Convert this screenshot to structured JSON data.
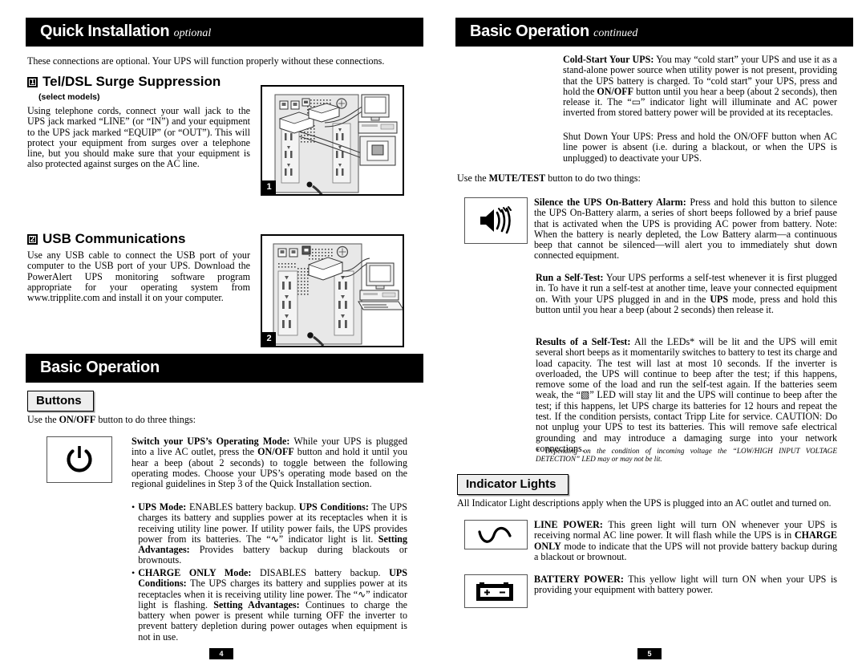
{
  "left_column": {
    "banner": {
      "title": "Quick Installation",
      "suffix": "optional"
    },
    "intro": "These connections are optional. Your UPS will function properly without these connections.",
    "step1": {
      "number": "1",
      "heading": "Tel/DSL Surge Suppression",
      "subnote": "(select models)",
      "body": "Using telephone cords, connect your wall jack to the UPS jack marked “LINE” (or “IN”) and  your equipment to the UPS jack marked “EQUIP” (or “OUT”). This will protect your equipment from surges over a telephone line, but you should make sure that your equipment is also protected against surges on the AC line.",
      "illustration_tag": "1"
    },
    "step2": {
      "number": "2",
      "heading": "USB Communications",
      "body": "Use any USB cable to connect the USB port of your computer to the USB port of your UPS. Download the PowerAlert UPS monitoring software program appropriate for your operating system from www.tripplite.com and install it on your computer.",
      "illustration_tag": "2"
    },
    "banner2": {
      "title": "Basic Operation",
      "suffix": ""
    },
    "buttons_head": "Buttons",
    "buttons_intro_pre": "Use the ",
    "buttons_intro_bold": "ON/OFF",
    "buttons_intro_post": " button to do three things:",
    "switch_mode": {
      "lead": "Switch your UPS’s Operating Mode:",
      "text_a": " While your UPS is plugged into a live AC outlet, press the ",
      "bold_b": "ON/OFF",
      "text_c": " button and hold it until you hear a beep (about 2 seconds) to toggle between the following operating modes. Choose your UPS’s operating mode based on the regional guidelines in Step 3 of the Quick Installation section.",
      "icon": "power-button-icon"
    },
    "ups_mode": {
      "bullet": "•",
      "lead": "UPS Mode:",
      "text_a": " ENABLES battery backup. ",
      "bold_b": "UPS Conditions:",
      "text_c": " The UPS charges its battery and supplies power at its receptacles when it is receiving utility line power. If utility power fails, the UPS provides power from its batteries. The “",
      "glyph": "∿",
      "text_d": "” indicator light is lit. ",
      "bold_e": "Setting Advantages:",
      "text_f": " Provides battery backup during blackouts or brownouts."
    },
    "charge_only_mode": {
      "bullet": "•",
      "lead": "CHARGE ONLY Mode:",
      "text_a": " DISABLES battery backup. ",
      "bold_b": "UPS Conditions:",
      "text_c": " The UPS charges its battery and supplies power at its receptacles when it is receiving utility line power. The “",
      "glyph": "∿",
      "text_d": "” indicator light is flashing. ",
      "bold_e": "Setting Advantages:",
      "text_f": " Continues to charge the battery when power is present while turning OFF the inverter to prevent battery depletion during power outages when equipment is not in use."
    },
    "page_number": "4"
  },
  "right_column": {
    "banner": {
      "title": "Basic Operation",
      "suffix": "continued"
    },
    "cold_start": {
      "lead": "Cold-Start Your UPS:",
      "text_a": " You may “cold start” your UPS and use it as a stand-alone power source when utility power is not present, providing that the UPS battery is charged. To “cold start” your UPS, press and hold the ",
      "bold_b": "ON/OFF",
      "text_c": " button until you hear a beep (about 2 seconds), then release it. The “",
      "glyph": "▭",
      "text_d": "” indicator light will illuminate and AC power inverted from stored battery power will be provided at its receptacles."
    },
    "shut_down": "Shut Down Your UPS: Press and hold the ON/OFF button when AC line power is absent (i.e. during a blackout, or when the UPS is unplugged) to deactivate your UPS.",
    "mute_intro_pre": "Use the ",
    "mute_intro_bold": "MUTE/TEST",
    "mute_intro_post": " button to do two things:",
    "silence_alarm": {
      "lead": "Silence the UPS On-Battery Alarm:",
      "text": " Press and hold this button to silence the UPS On-Battery alarm, a series of short beeps followed by a brief pause that is activated when the UPS is providing AC power from battery. Note: When the battery is nearly depleted, the Low Battery alarm—a continuous beep that cannot be silenced—will alert you to immediately shut down connected equipment.",
      "icon": "mute-speaker-icon"
    },
    "self_test": {
      "lead": "Run a Self-Test:",
      "text_a": " Your UPS performs a self-test whenever it is first plugged in. To have it run a self-test at another time, leave your connected equipment on. With your UPS plugged in and in the ",
      "bold_b": "UPS",
      "text_c": " mode, press and hold this button until you hear a beep (about 2 seconds) then release it."
    },
    "self_test_results": {
      "lead": "Results of a Self-Test:",
      "text_a": " All the LEDs* will be lit and the UPS will emit several short beeps as it momentarily switches to battery to test its charge and load capacity. The test will last at most 10 seconds. If the inverter is overloaded, the UPS will continue to beep after the test; if this happens, remove some of the load and run the self-test again. If the batteries seem weak, the “",
      "glyph": "▧",
      "text_b": "” LED will stay lit and the UPS will continue to beep after the test; if this happens, let UPS charge its batteries for 12 hours and repeat the test. If the condition persists, contact Tripp Lite for service. CAUTION: Do not unplug your UPS to test its batteries. This will remove safe electrical grounding and may introduce a damaging surge into your network connections."
    },
    "footnote": "* Depending on the condition of incoming voltage the “LOW/HIGH INPUT VOLTAGE DETECTION” LED may or may not be lit.",
    "indicator_head": "Indicator Lights",
    "indicator_intro": "All Indicator Light descriptions apply when the UPS is plugged into an AC outlet and turned on.",
    "line_power": {
      "lead": "LINE POWER:",
      "text_a": " This green light will turn ON whenever your UPS is receiving normal AC line power. It will flash while the UPS is in ",
      "bold_b": "CHARGE ONLY",
      "text_c": " mode to indicate that the UPS will not provide battery backup during a blackout or brownout.",
      "icon": "sine-wave-icon"
    },
    "battery_power": {
      "lead": "BATTERY POWER:",
      "text": " This yellow light will turn ON when your UPS is providing your equipment with battery power.",
      "icon": "battery-icon"
    },
    "page_number": "5"
  }
}
